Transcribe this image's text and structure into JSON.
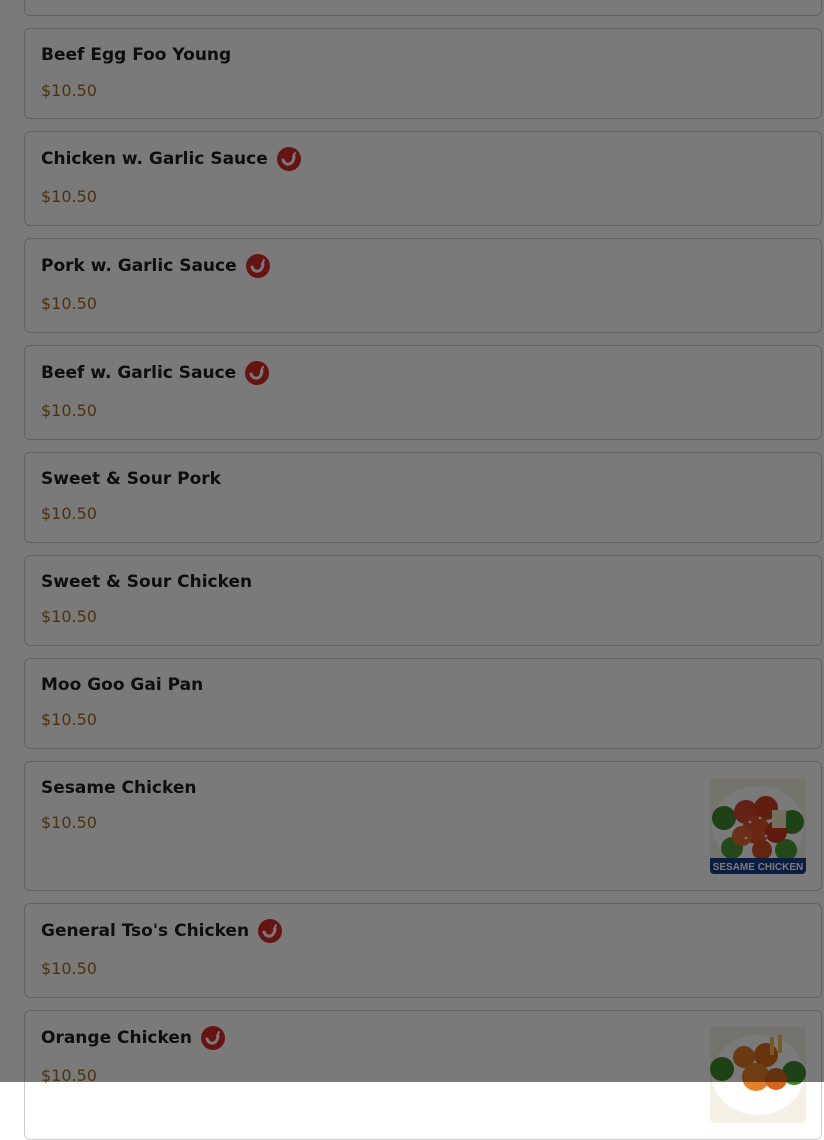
{
  "menu": {
    "items": [
      {
        "name": "Beef Egg Foo Young",
        "price": "$10.50",
        "spicy": false
      },
      {
        "name": "Chicken w. Garlic Sauce",
        "price": "$10.50",
        "spicy": true
      },
      {
        "name": "Pork w. Garlic Sauce",
        "price": "$10.50",
        "spicy": true
      },
      {
        "name": "Beef w. Garlic Sauce",
        "price": "$10.50",
        "spicy": true
      },
      {
        "name": "Sweet & Sour Pork",
        "price": "$10.50",
        "spicy": false
      },
      {
        "name": "Sweet & Sour Chicken",
        "price": "$10.50",
        "spicy": false
      },
      {
        "name": "Moo Goo Gai Pan",
        "price": "$10.50",
        "spicy": false
      },
      {
        "name": "Sesame Chicken",
        "price": "$10.50",
        "spicy": false,
        "image_caption": "SESAME CHICKEN"
      },
      {
        "name": "General Tso's Chicken",
        "price": "$10.50",
        "spicy": true
      },
      {
        "name": "Orange Chicken",
        "price": "$10.50",
        "spicy": true
      }
    ]
  },
  "colors": {
    "price": "#a06a1c",
    "spicy_icon": "#d62828",
    "modal_overlay": "rgba(0,0,0,0.52)"
  }
}
